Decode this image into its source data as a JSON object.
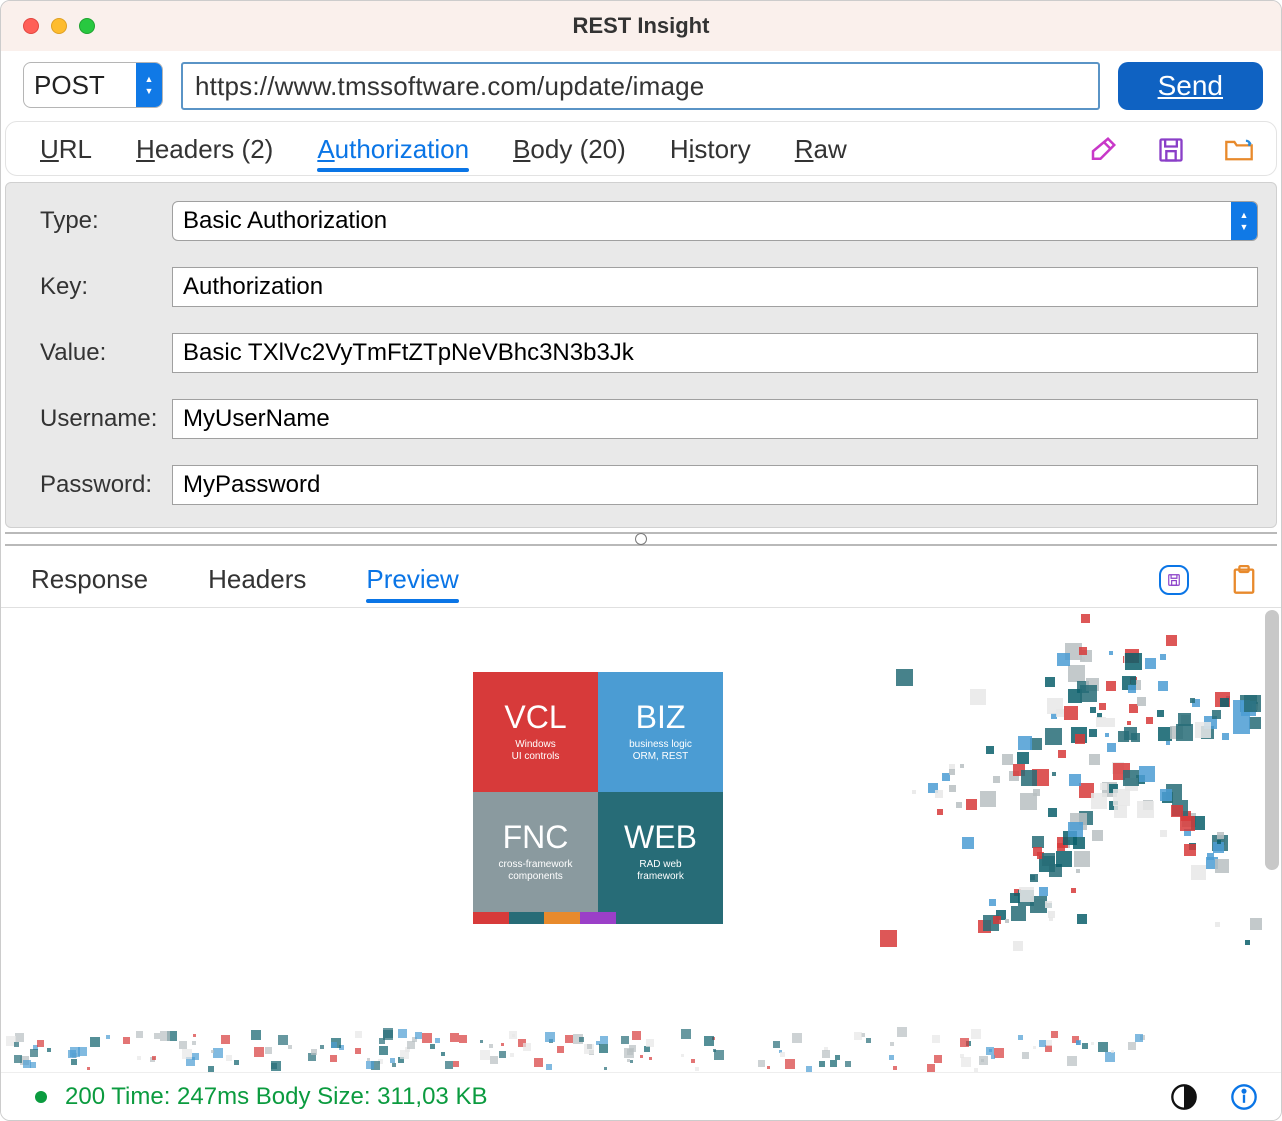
{
  "window": {
    "title": "REST Insight"
  },
  "request": {
    "method": "POST",
    "url": "https://www.tmssoftware.com/update/image",
    "send_label": "Send"
  },
  "tabs": {
    "url": "URL",
    "headers": "Headers (2)",
    "authorization": "Authorization",
    "body": "Body (20)",
    "history": "History",
    "raw": "Raw",
    "active": "authorization"
  },
  "auth": {
    "type_label": "Type:",
    "type_value": "Basic Authorization",
    "key_label": "Key:",
    "key_value": "Authorization",
    "value_label": "Value:",
    "value_value": "Basic TXlVc2VyTmFtZTpNeVBhc3N3b3Jk",
    "username_label": "Username:",
    "username_value": "MyUserName",
    "password_label": "Password:",
    "password_value": "MyPassword"
  },
  "response_tabs": {
    "response": "Response",
    "headers": "Headers",
    "preview": "Preview",
    "active": "preview"
  },
  "preview_tiles": {
    "vcl": {
      "title": "VCL",
      "sub": "Windows\nUI controls"
    },
    "biz": {
      "title": "BIZ",
      "sub": "business logic\nORM, REST"
    },
    "fnc": {
      "title": "FNC",
      "sub": "cross-framework\ncomponents"
    },
    "web": {
      "title": "WEB",
      "sub": "RAD web\nframework"
    }
  },
  "status": {
    "text": "200 Time: 247ms Body Size: 311,03 KB"
  },
  "colors": {
    "accent": "#0a75e6",
    "send": "#0f62c2",
    "green": "#0b9b3f",
    "magenta": "#b040c8",
    "orange": "#e88a2c"
  },
  "icons": {
    "eraser": "eraser-icon",
    "save": "save-icon",
    "open": "open-folder-icon",
    "clipboard": "clipboard-icon",
    "contrast": "contrast-icon",
    "info": "info-icon"
  }
}
